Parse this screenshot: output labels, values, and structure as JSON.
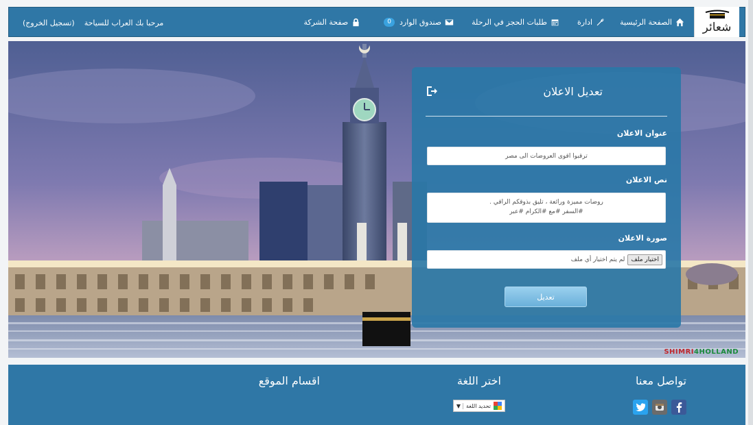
{
  "nav": {
    "logo_text": "شعائر",
    "home": "الصفحة الرئيسية",
    "admin": "ادارة",
    "bookings": "طلبات الحجز في الرحلة",
    "inbox": "صندوق الوارد",
    "inbox_count": "0",
    "company_page": "صفحة الشركة",
    "welcome": "مرحبا بك العراب للسياحة",
    "logout": "(تسجيل الخروج)"
  },
  "form": {
    "title": "تعديل الاعلان",
    "title_label": "عنوان الاعلان",
    "title_value": "ترقبوا اقوى العروضات الى مصر",
    "body_label": "نص الاعلان",
    "body_line1": "روضات مميزة ورائعة ، تليق بذوقكم الراقي .",
    "body_line2": "#السفر #مع #الكرام #عبر",
    "image_label": "صورة الاعلان",
    "file_button": "اختيار ملف",
    "file_status": "لم يتم اختيار أي ملف",
    "submit": "تعديل"
  },
  "hero": {
    "watermark_red": "SHIMRI",
    "watermark_green": "4HOLLAND"
  },
  "footer": {
    "contact_title": "تواصل معنا",
    "language_title": "اختر اللغة",
    "sections_title": "اقسام الموقع",
    "translate_label": "تحديد اللغة"
  },
  "colors": {
    "primary": "#2f77a6",
    "panel": "#2978a7",
    "facebook": "#3b5998",
    "twitter": "#2aa3ef",
    "instagram": "#6b6b6b"
  },
  "icons": [
    "home-icon",
    "wrench-icon",
    "calendar-icon",
    "envelope-icon",
    "lock-icon",
    "exit-icon",
    "facebook-icon",
    "instagram-icon",
    "twitter-icon",
    "google-translate-icon"
  ]
}
